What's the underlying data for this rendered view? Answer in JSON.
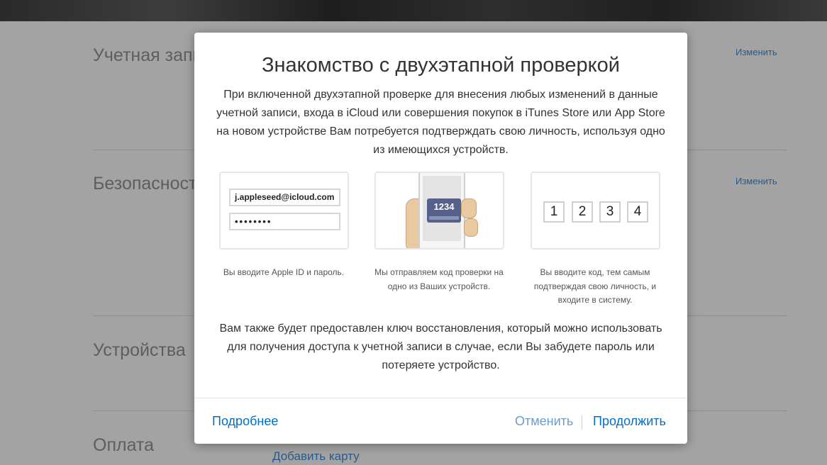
{
  "background": {
    "sections": [
      {
        "title": "Учетная запи"
      },
      {
        "title": "Безопасност"
      },
      {
        "title": "Устройства"
      },
      {
        "title": "Оплата"
      }
    ],
    "edit_link_1": "Изменить",
    "edit_link_2": "Изменить",
    "add_card_link": "Добавить карту"
  },
  "modal": {
    "title": "Знакомство с двухэтапной проверкой",
    "intro": "При включенной двухэтапной проверке для внесения любых изменений в данные учетной записи, входа в iCloud или совершения покупок в iTunes Store или App Store на новом устройстве Вам потребуется подтверждать свою личность, используя одно из имеющихся устройств.",
    "steps": [
      {
        "email": "j.appleseed@icloud.com",
        "password": "••••••••",
        "caption": "Вы вводите Apple ID и пароль."
      },
      {
        "code": "1234",
        "caption": "Мы отправляем код проверки на одно из Ваших устройств."
      },
      {
        "digits": [
          "1",
          "2",
          "3",
          "4"
        ],
        "caption": "Вы вводите код, тем самым подтверждая свою личность, и входите в систему."
      }
    ],
    "recovery_text": "Вам также будет предоставлен ключ восстановления, который можно использовать для получения доступа к учетной записи в случае, если Вы забудете пароль или потеряете устройство.",
    "footer": {
      "learn_more": "Подробнее",
      "cancel": "Отменить",
      "continue": "Продолжить"
    }
  },
  "colors": {
    "link": "#0070c9",
    "overlay": "#a3a3a3",
    "code_badge": "#56608a"
  }
}
